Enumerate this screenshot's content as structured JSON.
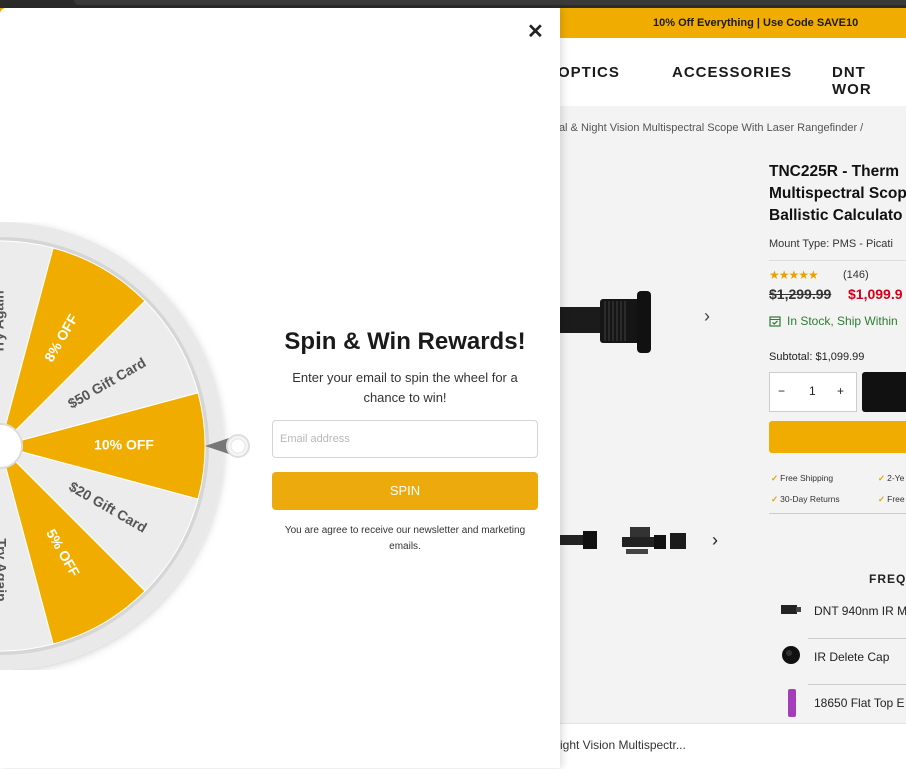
{
  "promo": {
    "text": "10% Off Everything | Use Code SAVE10"
  },
  "nav": {
    "items": [
      "OPTICS",
      "ACCESSORIES",
      "DNT WOR"
    ]
  },
  "breadcrumb": {
    "text": "ermal & Night Vision Multispectral Scope With Laser Rangefinder /"
  },
  "product": {
    "title_lines": [
      "TNC225R - Therm",
      "Multispectral Scop",
      "Ballistic Calculato"
    ],
    "mount_type": "Mount Type: PMS - Picati",
    "rating_count": "(146)",
    "rating_stars": 5,
    "old_price": "$1,299.99",
    "new_price": "$1,099.9",
    "stock": "In Stock, Ship Within",
    "subtotal": "Subtotal: $1,099.99",
    "quantity": "1",
    "qty_minus": "−",
    "qty_plus": "+",
    "perks": [
      "Free Shipping",
      "2-Ye",
      "30-Day Returns",
      "Free"
    ]
  },
  "frequently": {
    "heading": "FREQU",
    "items": [
      "DNT 940nm IR M",
      "IR Delete Cap",
      "18650 Flat Top E"
    ]
  },
  "bottom_bar": {
    "text": "ight Vision Multispectr..."
  },
  "gallery": {
    "next_glyph": "›",
    "thumb_next_glyph": "›"
  },
  "popup": {
    "close_glyph": "✕",
    "heading": "Spin & Win Rewards!",
    "subtext": "Enter your email to spin the wheel for a chance to win!",
    "email_placeholder": "Email address",
    "spin_label": "SPIN",
    "disclaimer": "You are agree to receive our newsletter and marketing emails.",
    "wheel_segments": [
      "Try Again",
      "8% OFF",
      "$50 Gift Card",
      "10% OFF",
      "$20 Gift Card",
      "5% OFF",
      "Try Again"
    ]
  },
  "colors": {
    "accent": "#f0ad00",
    "wheel_gold": "#f0ad00",
    "wheel_grey": "#ececec",
    "sale_price": "#d0021b",
    "stock_green": "#2e7d32"
  }
}
